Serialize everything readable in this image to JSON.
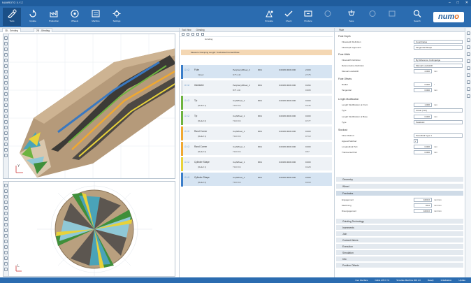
{
  "window": {
    "title": "NUMROTO X.Y.Z",
    "buttons": [
      "–",
      "□",
      "✕"
    ]
  },
  "ribbon": {
    "left": [
      {
        "label": "Tools",
        "icon": "tool-icon"
      },
      {
        "label": "Update",
        "icon": "update-icon"
      },
      {
        "label": "Production",
        "icon": "production-icon"
      },
      {
        "label": "Wheels",
        "icon": "wheel-icon"
      },
      {
        "label": "Machine",
        "icon": "machine-icon"
      },
      {
        "label": "Settings",
        "icon": "gear-icon"
      }
    ],
    "right": [
      {
        "label": "Simulate",
        "icon": "simulate-icon"
      },
      {
        "label": "Check",
        "icon": "check-icon"
      },
      {
        "label": "Produce",
        "icon": "produce-icon"
      },
      {
        "label": "",
        "icon": "dim-icon"
      },
      {
        "label": "Save",
        "icon": "save-icon"
      },
      {
        "label": "",
        "icon": "dim-icon-2"
      },
      {
        "label": "",
        "icon": "dim-icon-3"
      },
      {
        "label": "Search",
        "icon": "search-icon"
      }
    ],
    "logo": {
      "main": "num",
      "accent": "o"
    }
  },
  "file_tabs": [
    "3D - Grinding",
    "2D - Grinding"
  ],
  "views": {
    "main_axis": "Y",
    "end_axis": "L"
  },
  "op_panel": {
    "tabs": [
      "Tool View",
      "Grinding"
    ],
    "title": "Grinding",
    "bar_label": "Measure Clamping Length: Toolholder/Contact/Plate",
    "rows": [
      {
        "name": "Flute",
        "sub": "Infeed",
        "wheel": "PeripheryWheel_2",
        "wheel2": "D75 L40",
        "c3": "RD1",
        "c4": "0.000/0.000/0.000",
        "c5": "2.000",
        "c5b": "2.775",
        "stripe": "#8fb3d9"
      },
      {
        "name": "Gashlube",
        "sub": "",
        "wheel": "PeripheryWheel_2",
        "wheel2": "B75 L40",
        "c3": "RD1",
        "c4": "0.000/0.000/0.000",
        "c5": "0.294",
        "c5b": "0.908",
        "stripe": "#e0e6ec"
      },
      {
        "name": "Tip",
        "sub": "(Relief 1)",
        "wheel": "CupWheel_1",
        "wheel2": "T100 D4",
        "c3": "RD1",
        "c4": "0.000/0.000/0.000",
        "c5": "0.000",
        "c5b": "0.446",
        "stripe": "#6db33f"
      },
      {
        "name": "Tip",
        "sub": "(Relief 2)",
        "wheel": "CupWheel_1",
        "wheel2": "T100 D4",
        "c3": "RD1",
        "c4": "0.000/0.000/0.000",
        "c5": "0.000",
        "c5b": "0.777",
        "stripe": "#6db33f"
      },
      {
        "name": "Rand Corner",
        "sub": "(Relief 1)",
        "wheel": "CupWheel_1",
        "wheel2": "T100 D4",
        "c3": "RD1",
        "c4": "0.000/0.000/0.000",
        "c5": "0.000",
        "c5b": "0.713",
        "stripe": "#f0a830"
      },
      {
        "name": "Rand Corner",
        "sub": "(Relief 2)",
        "wheel": "CupWheel_1",
        "wheel2": "T100 D4",
        "c3": "RD1",
        "c4": "0.000/0.000/0.000",
        "c5": "0.000",
        "c5b": "0.57",
        "stripe": "#f0a830"
      },
      {
        "name": "Cylinder Shape",
        "sub": "(Relief 1)",
        "wheel": "CupWheel_1",
        "wheel2": "T100 D4",
        "c3": "RD1",
        "c4": "0.000/0.000/0.000",
        "c5": "0.000",
        "c5b": "0.428",
        "stripe": "#e8d23a"
      },
      {
        "name": "Cylinder Shape",
        "sub": "(Relief 2)",
        "wheel": "CupWheel_1",
        "wheel2": "T100 D4",
        "c3": "RD1",
        "c4": "0.000/0.000/0.000",
        "c5": "0.000",
        "c5b": "0.419",
        "stripe": "#3a7dc9"
      }
    ]
  },
  "props": {
    "header": "Flute",
    "flute_depth": {
      "title": "Flute Depth",
      "def_label": "Flutedepth Definition",
      "def_value": "Coordinates",
      "app_label": "Flutedepth Approach",
      "app_value": "Tangential Shape"
    },
    "flute_width": {
      "title": "Flute Width",
      "def_label": "Flutewidth Definition",
      "def_value": "By Reference Cuttingedge",
      "ref_label": "Referenceline Definition",
      "ref_value": "Manual Landwidth",
      "manual_label": "Manual Landwidth",
      "manual_value": "2.000",
      "manual_unit": "mm"
    },
    "flute_offsets": {
      "title": "Flute Offsets",
      "radial_label": "Radial",
      "radial_value": "0.000",
      "radial_unit": "°",
      "tangential_label": "Tangential",
      "tangential_value": "0.000",
      "tangential_unit": "mm"
    },
    "length_mod": {
      "title": "Length Modification",
      "front_label": "Length Modification at Front",
      "front_value": "1.000",
      "front_unit": "mm",
      "type1_label": "Type",
      "type1_value": "Linear (mm)",
      "base_label": "Length Modification at Base",
      "base_value": "0.000",
      "base_unit": "mm",
      "type2_label": "Type",
      "type2_value": "Parabolic"
    },
    "stockout": {
      "title": "Stockout",
      "method_label": "Flute Method",
      "method_value": "Periodical Type 1",
      "append_label": "Append Method",
      "append_value": "✓",
      "long_label": "Longitudinal Part",
      "long_value": "0.000",
      "long_unit": "mm",
      "trans_label": "Transversal Part",
      "trans_value": "0.000",
      "trans_unit": "mm"
    },
    "sections": [
      "Geometry",
      "Wheel",
      "Feedrates",
      "Grinding Technology",
      "Increments",
      "Join",
      "Coolant Valves",
      "Execution",
      "Simulation",
      "Info",
      "Position Offsets"
    ],
    "feedrates": {
      "eng_label": "Engagement",
      "eng_value": "1000.0",
      "eng_unit": "mm/min",
      "mach_label": "Machining",
      "mach_value": "80.0",
      "mach_unit": "mm/min",
      "dis_label": "Disengagement",
      "dis_value": "1000.0",
      "dis_unit": "mm/min"
    }
  },
  "status": {
    "items": [
      "Live Interface",
      "Cable 2/8 X.Y.Z",
      "Simulate Machine 000 2.0",
      "Ready",
      "Initialisation",
      "Update"
    ]
  }
}
